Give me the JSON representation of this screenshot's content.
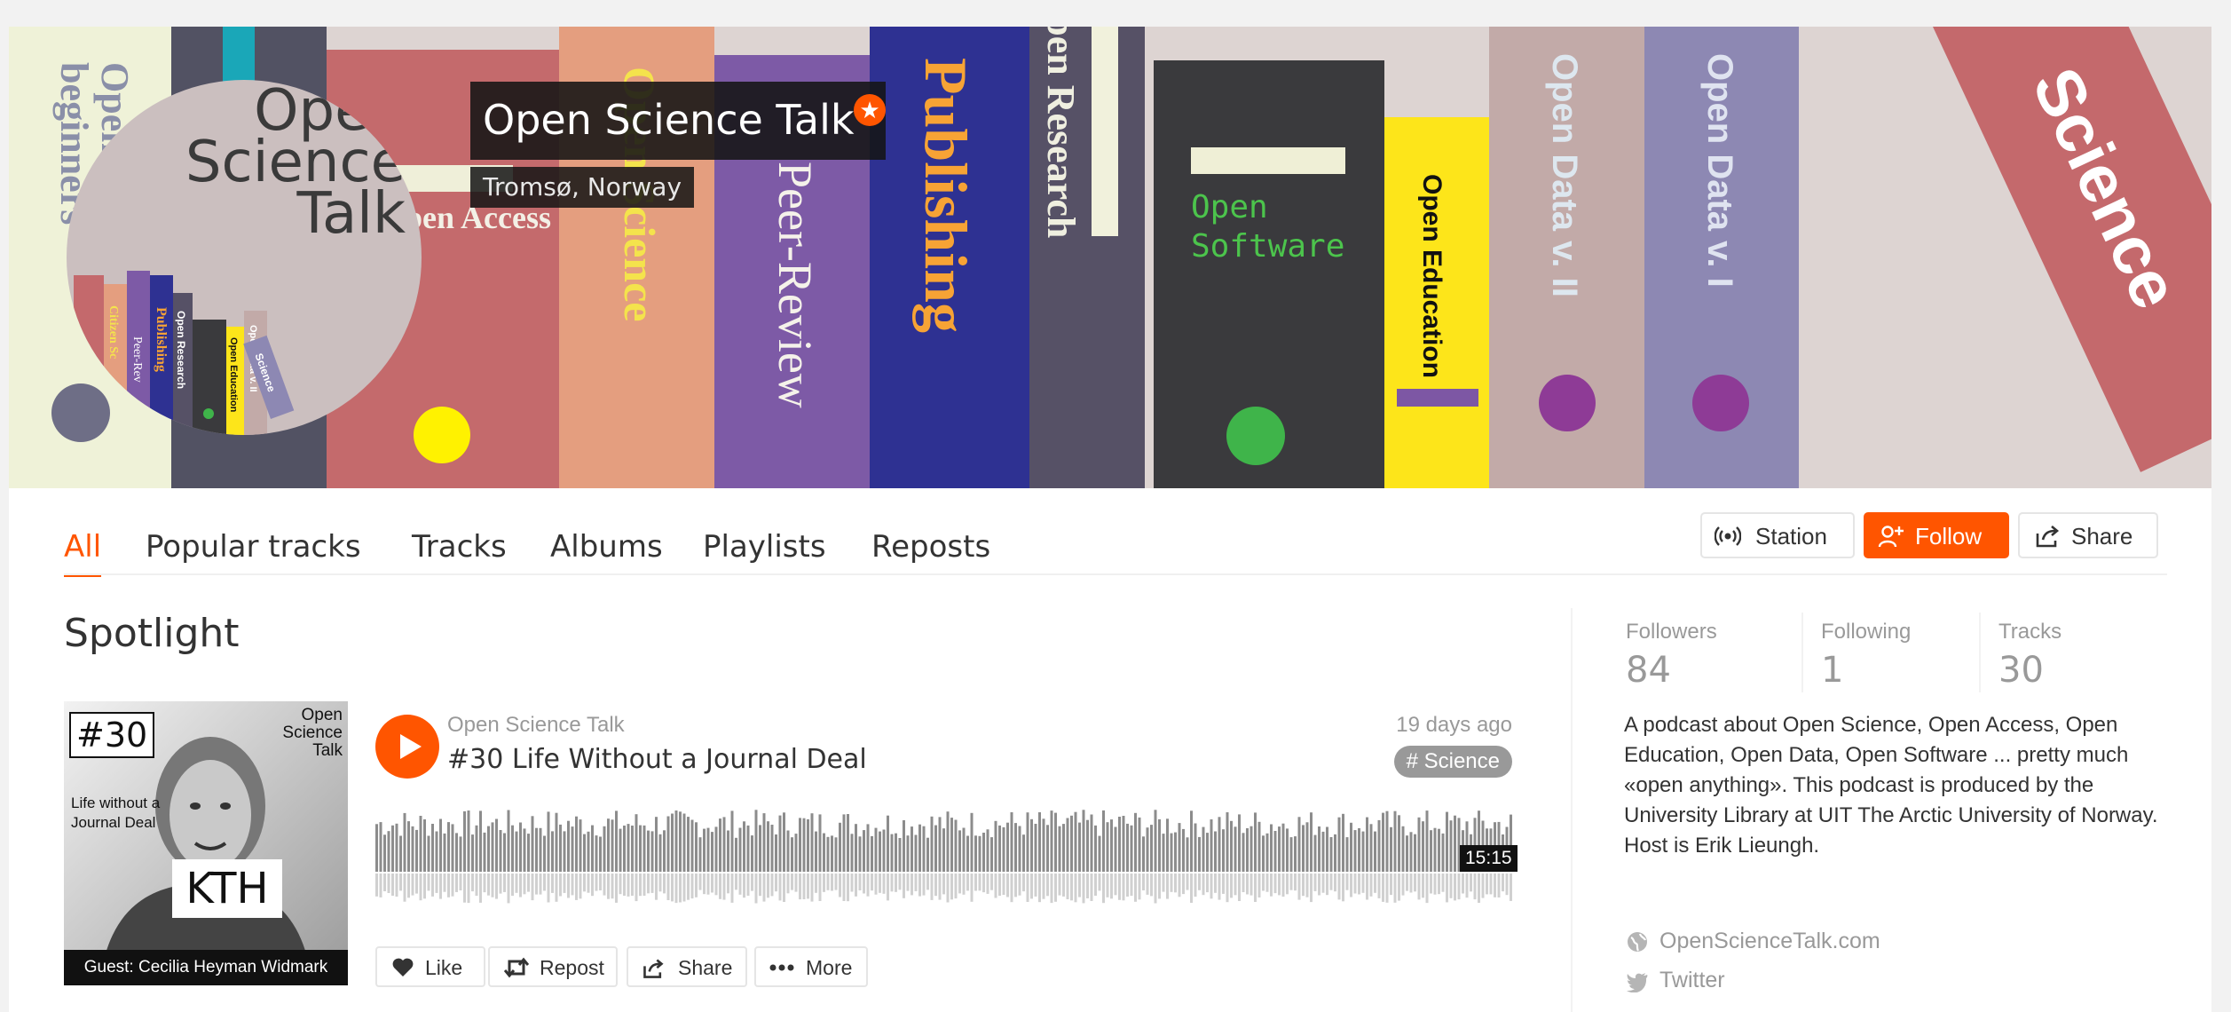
{
  "profile": {
    "name": "Open Science Talk",
    "location": "Tromsø, Norway",
    "badge_icon": "star-icon",
    "accent": "#ff5500"
  },
  "banner": {
    "logo_text": [
      "Open",
      "Science",
      "Talk"
    ],
    "spines": {
      "beginners": "Open Science for beginners",
      "access": "Open Access",
      "science": "Open Science",
      "peer_review": "Peer-Review",
      "publishing": "Publishing",
      "research": "Open Research",
      "software": [
        "Open",
        "Software"
      ],
      "education": "Open Education",
      "data2": "Open Data v. II",
      "data1": "Open Data v. I",
      "science_big": "Science"
    },
    "mini_spines": {
      "citizen": "Citizen Sc",
      "peer": "Peer-Rev",
      "publishing": "Publishing",
      "research": "Open Research",
      "education": "Open Education",
      "data": "Open Data v. II",
      "science": "Science"
    }
  },
  "tabs": [
    {
      "label": "All",
      "active": true
    },
    {
      "label": "Popular tracks",
      "active": false
    },
    {
      "label": "Tracks",
      "active": false
    },
    {
      "label": "Albums",
      "active": false
    },
    {
      "label": "Playlists",
      "active": false
    },
    {
      "label": "Reposts",
      "active": false
    }
  ],
  "actions": {
    "station": {
      "label": "Station",
      "icon": "broadcast-icon"
    },
    "follow": {
      "label": "Follow",
      "icon": "add-user-icon"
    },
    "share": {
      "label": "Share",
      "icon": "share-icon"
    }
  },
  "spotlight": {
    "heading": "Spotlight",
    "artwork": {
      "episode": "#30",
      "show": [
        "Open",
        "Science",
        "Talk"
      ],
      "subtitle": [
        "Life without a",
        "Journal Deal"
      ],
      "sign": "KTH",
      "guest": "Guest: Cecilia Heyman Widmark"
    },
    "track": {
      "user": "Open Science Talk",
      "title": "#30 Life Without a Journal Deal",
      "posted": "19 days ago",
      "tag": "# Science",
      "duration": "15:15",
      "progress": 0
    },
    "buttons": [
      {
        "label": "Like",
        "icon": "heart-icon"
      },
      {
        "label": "Repost",
        "icon": "repost-icon"
      },
      {
        "label": "Share",
        "icon": "share-icon"
      },
      {
        "label": "More",
        "icon": "more-icon"
      }
    ]
  },
  "stats": [
    {
      "label": "Followers",
      "value": "84"
    },
    {
      "label": "Following",
      "value": "1"
    },
    {
      "label": "Tracks",
      "value": "30"
    }
  ],
  "bio": "A podcast about Open Science, Open Access, Open Education, Open Data, Open Software ... pretty much «open anything». This podcast is produced by the University Library at UIT The Arctic University of Norway. Host is Erik Lieungh.",
  "links": [
    {
      "label": "OpenScienceTalk.com",
      "icon": "globe-icon"
    },
    {
      "label": "Twitter",
      "icon": "twitter-icon"
    }
  ]
}
